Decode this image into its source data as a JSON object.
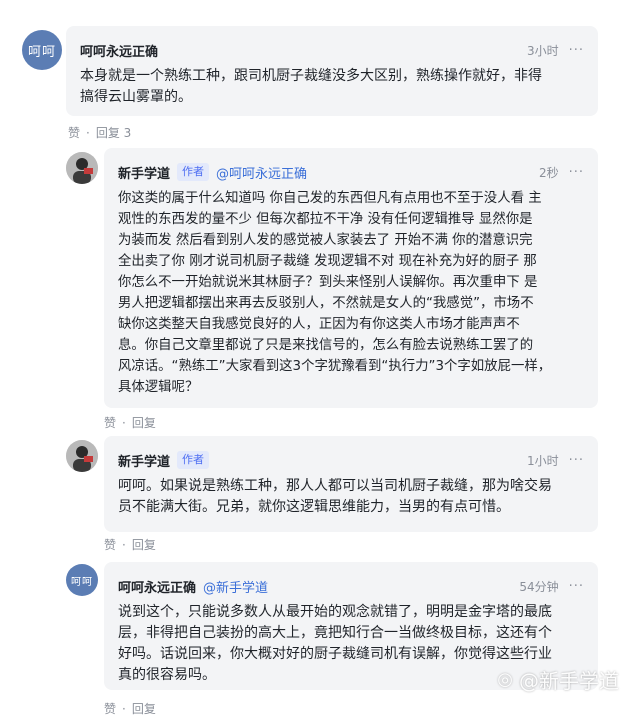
{
  "comments": [
    {
      "author": "呵呵永远正确",
      "avatar_text": "呵呵",
      "time": "3小时",
      "more_icon": "more-icon",
      "content": "本身就是一个熟练工种，跟司机厨子裁缝没多大区别，熟练操作就好，非得\n搞得云山雾罩的。",
      "like_label": "赞",
      "reply_label": "回复 3"
    },
    {
      "author": "新手学道",
      "author_tag": "作者",
      "mention": "@呵呵永远正确",
      "time": "2秒",
      "content": "你这类的属于什么知道吗 你自己发的东西但凡有点用也不至于没人看 主\n观性的东西发的量不少 但每次都拉不干净 没有任何逻辑推导 显然你是\n为装而发 然后看到别人发的感觉被人家装去了 开始不满 你的潜意识完\n全出卖了你 刚才说司机厨子裁缝 发现逻辑不对 现在补充为好的厨子 那\n你怎么不一开始就说米其林厨子？到头来怪别人误解你。再次重申下 是\n男人把逻辑都摆出来再去反驳别人，不然就是女人的“我感觉”，市场不\n缺你这类整天自我感觉良好的人，正因为有你这类人市场才能声声不\n息。你自己文章里都说了只是来找信号的，怎么有脸去说熟练工罢了的\n风凉话。“熟练工”大家看到这3个字犹豫看到“执行力”3个字如放屁一样，\n具体逻辑呢？",
      "like_label": "赞",
      "reply_label": "回复"
    },
    {
      "author": "新手学道",
      "author_tag": "作者",
      "time": "1小时",
      "content": "呵呵。如果说是熟练工种，那人人都可以当司机厨子裁缝，那为啥交易\n员不能满大街。兄弟，就你这逻辑思维能力，当男的有点可惜。",
      "like_label": "赞",
      "reply_label": "回复"
    },
    {
      "author": "呵呵永远正确",
      "avatar_text": "呵呵",
      "mention": "@新手学道",
      "time": "54分钟",
      "content": "说到这个，只能说多数人从最开始的观念就错了，明明是金字塔的最底\n层，非得把自己装扮的高大上，竟把知行合一当做终极目标，这还有个\n好吗。话说回来，你大概对好的厨子裁缝司机有误解，你觉得这些行业\n真的很容易吗。",
      "like_label": "赞",
      "reply_label": "回复"
    }
  ],
  "watermark": {
    "icon": "zhihu-icon",
    "text": "@新手学道"
  }
}
